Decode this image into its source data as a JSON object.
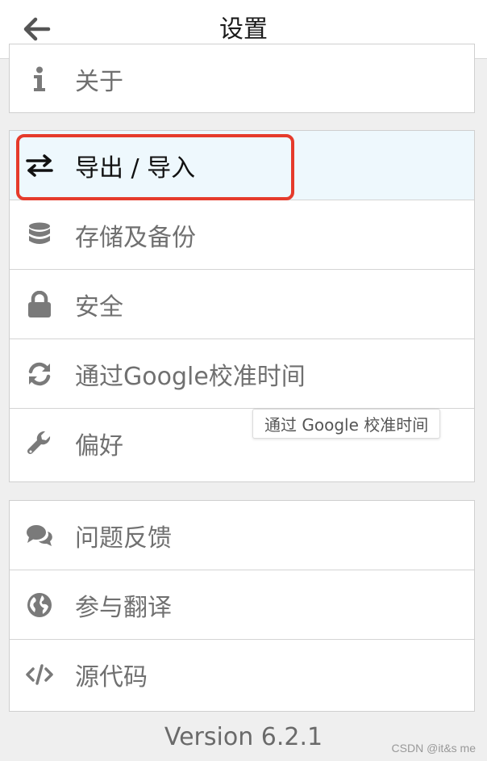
{
  "header": {
    "title": "设置",
    "back_icon": "arrow-left-icon"
  },
  "groups": [
    {
      "rows": [
        {
          "label": "关于",
          "icon": "info-icon"
        }
      ]
    },
    {
      "rows": [
        {
          "label": "导出 / 导入",
          "icon": "exchange-icon",
          "active": true
        },
        {
          "label": "存储及备份",
          "icon": "database-icon"
        },
        {
          "label": "安全",
          "icon": "lock-icon"
        },
        {
          "label": "通过Google校准时间",
          "icon": "sync-icon"
        },
        {
          "label": "偏好",
          "icon": "wrench-icon"
        }
      ]
    },
    {
      "rows": [
        {
          "label": "问题反馈",
          "icon": "comments-icon"
        },
        {
          "label": "参与翻译",
          "icon": "globe-icon"
        },
        {
          "label": "源代码",
          "icon": "code-icon"
        }
      ]
    }
  ],
  "tooltip": "通过 Google 校准时间",
  "version": "Version 6.2.1",
  "watermark": "CSDN @it&s me",
  "colors": {
    "highlight_border": "#e53b2c",
    "active_row_bg": "#eef8fd",
    "icon_gray": "#7a7a7a"
  }
}
